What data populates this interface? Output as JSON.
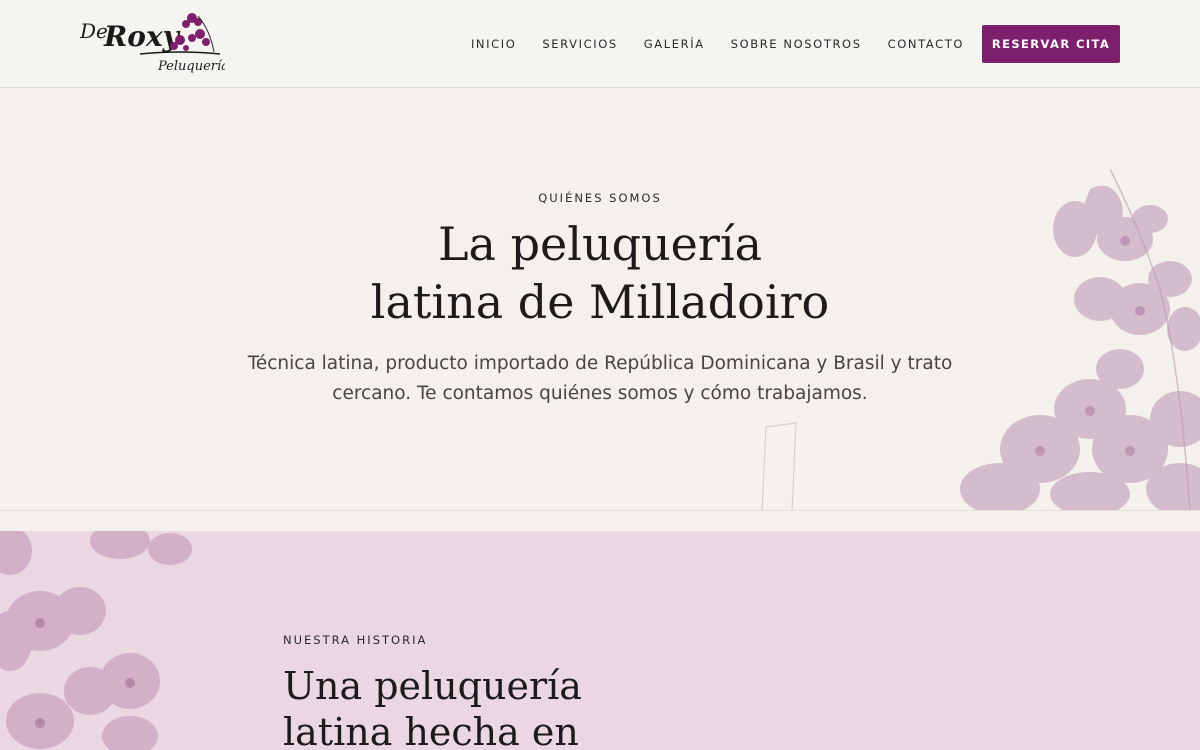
{
  "brand": {
    "logo_text_de": "De",
    "logo_text_roxy": "Roxy",
    "logo_text_peluqueria": "Peluquería",
    "accent_color": "#7d1f6b"
  },
  "nav": {
    "items": [
      {
        "label": "INICIO"
      },
      {
        "label": "SERVICIOS"
      },
      {
        "label": "GALERÍA"
      },
      {
        "label": "SOBRE NOSOTROS"
      },
      {
        "label": "CONTACTO"
      }
    ],
    "cta_label": "RESERVAR CITA"
  },
  "hero": {
    "eyebrow": "QUIÉNES SOMOS",
    "title_line1": "La peluquería",
    "title_line2": "latina de Milladoiro",
    "subtitle_line1": "Técnica latina, producto importado de República Dominicana y Brasil y trato",
    "subtitle_line2": "cercano. Te contamos quiénes somos y cómo trabajamos.",
    "decoration_icon": "orchid-flowers"
  },
  "story": {
    "eyebrow": "NUESTRA HISTORIA",
    "title_line1": "Una peluquería",
    "title_line2": "latina hecha en",
    "background_color": "#ead7e2",
    "decoration_icon": "orchid-flowers"
  }
}
